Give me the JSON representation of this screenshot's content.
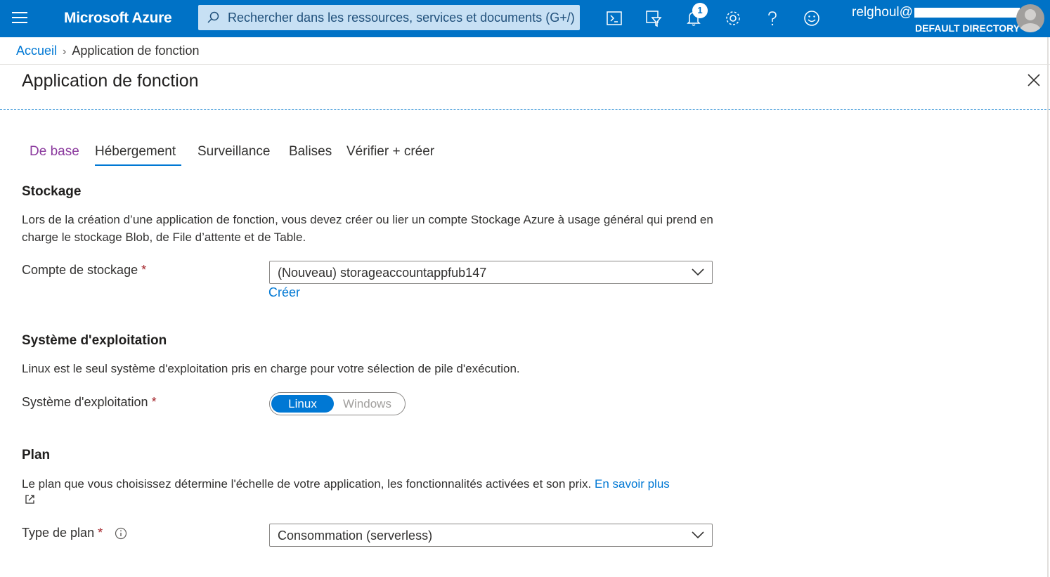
{
  "header": {
    "brand": "Microsoft Azure",
    "search_placeholder": "Rechercher dans les ressources, services et documents (G+/)",
    "notification_count": "1",
    "account_email": "relghoul@",
    "directory": "DEFAULT DIRECTORY",
    "icons": [
      "menu-icon",
      "search-icon",
      "cloud-shell-icon",
      "directory-filter-icon",
      "notifications-icon",
      "settings-icon",
      "help-icon",
      "feedback-icon",
      "avatar"
    ]
  },
  "breadcrumb": {
    "home": "Accueil",
    "current": "Application de fonction"
  },
  "page": {
    "title": "Application de fonction"
  },
  "tabs": [
    {
      "label": "De base",
      "state": "visited"
    },
    {
      "label": "Hébergement",
      "state": "active"
    },
    {
      "label": "Surveillance",
      "state": "default"
    },
    {
      "label": "Balises",
      "state": "default"
    },
    {
      "label": "Vérifier + créer",
      "state": "default"
    }
  ],
  "storage": {
    "title": "Stockage",
    "description": "Lors de la création d’une application de fonction, vous devez créer ou lier un compte Stockage Azure à usage général qui prend en charge le stockage Blob, de File d’attente et de Table.",
    "field_label": "Compte de stockage",
    "required_mark": "*",
    "selected": "(Nouveau) storageaccountappfub147",
    "create_link": "Créer"
  },
  "os": {
    "title": "Système d'exploitation",
    "description": "Linux est le seul système d'exploitation pris en charge pour votre sélection de pile d'exécution.",
    "field_label": "Système d'exploitation",
    "required_mark": "*",
    "options": [
      "Linux",
      "Windows"
    ],
    "selected": "Linux"
  },
  "plan": {
    "title": "Plan",
    "description": "Le plan que vous choisissez détermine l'échelle de votre application, les fonctionnalités activées et son prix.",
    "learn_more": "En savoir plus",
    "field_label": "Type de plan",
    "required_mark": "*",
    "selected": "Consommation (serverless)"
  },
  "colors": {
    "topbar": "#0072c6",
    "accent": "#0078d4",
    "visited_tab": "#8b3a9e",
    "required": "#a4262c"
  }
}
